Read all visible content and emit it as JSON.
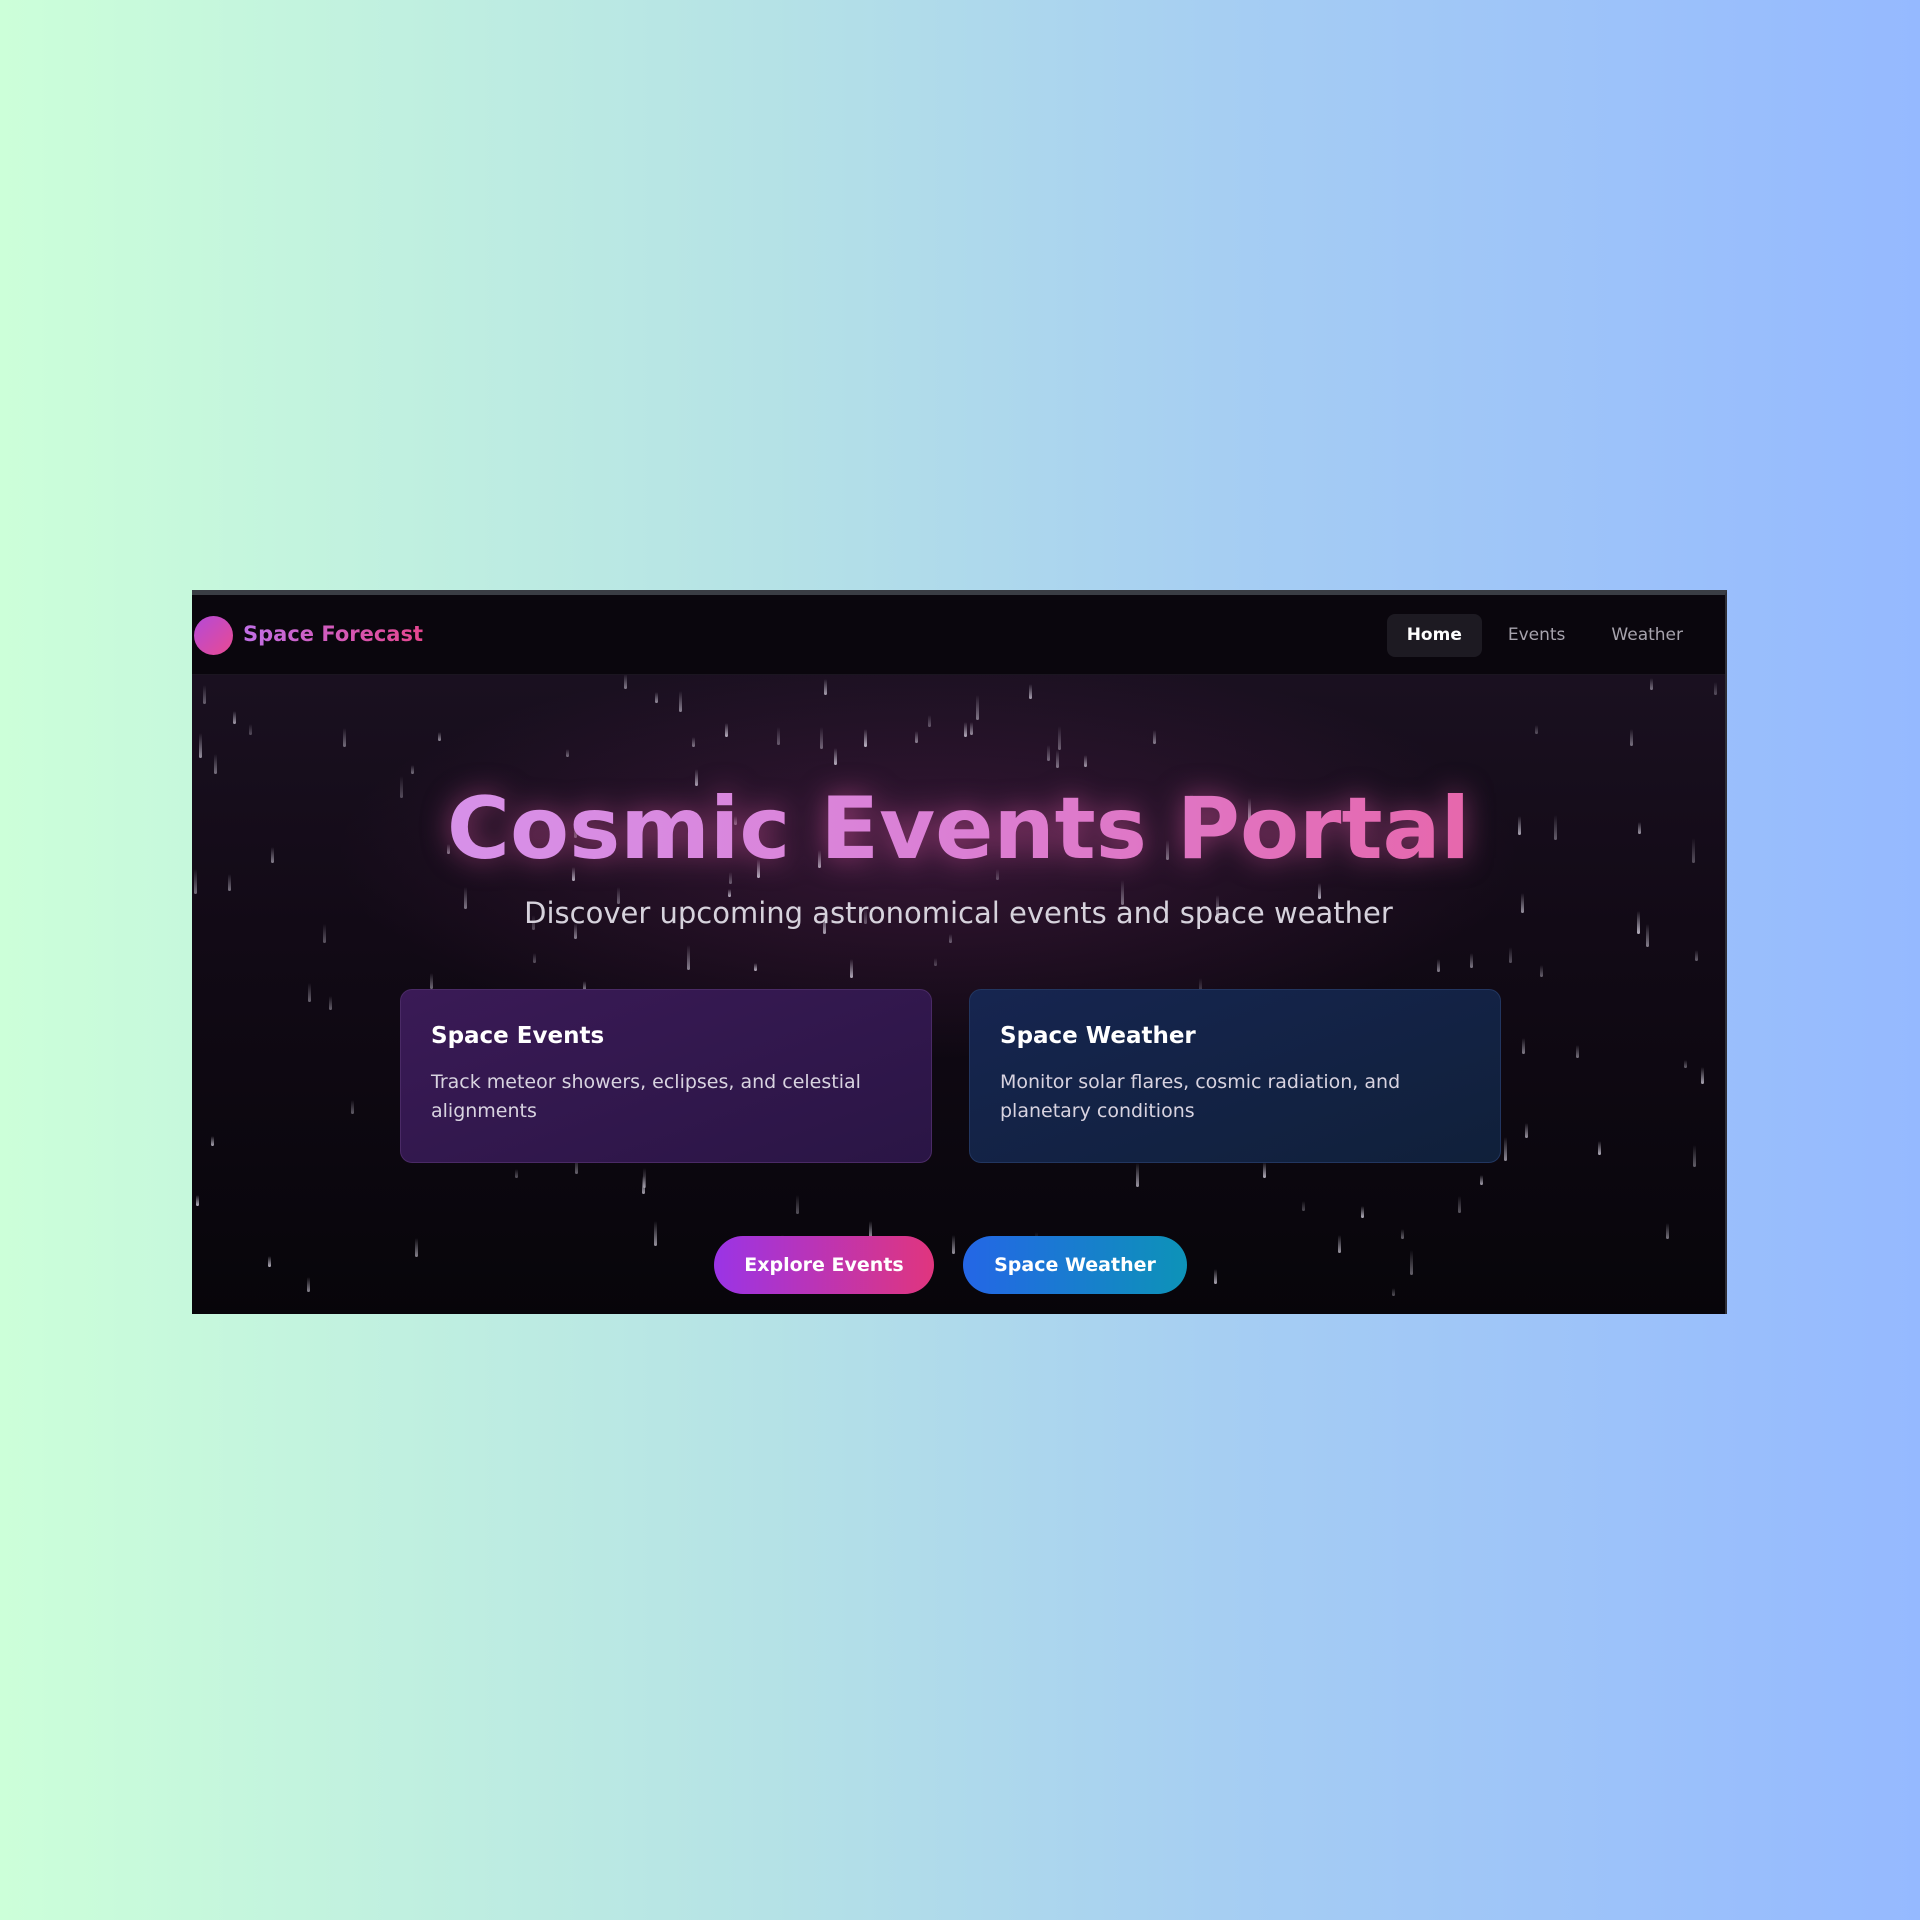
{
  "header": {
    "brand": "Space Forecast",
    "nav": [
      {
        "label": "Home",
        "active": true
      },
      {
        "label": "Events",
        "active": false
      },
      {
        "label": "Weather",
        "active": false
      }
    ]
  },
  "hero": {
    "title": "Cosmic Events Portal",
    "subtitle": "Discover upcoming astronomical events and space weather"
  },
  "cards": [
    {
      "title": "Space Events",
      "text": "Track meteor showers, eclipses, and celestial alignments"
    },
    {
      "title": "Space Weather",
      "text": "Monitor solar flares, cosmic radiation, and planetary conditions"
    }
  ],
  "buttons": {
    "explore": "Explore Events",
    "weather": "Space Weather"
  },
  "colors": {
    "accent_purple": "#9a34e6",
    "accent_pink": "#e0357e",
    "accent_blue": "#2466e6",
    "accent_teal": "#0d93b8"
  },
  "icons": {
    "logo": "gradient-circle-logo-icon"
  }
}
